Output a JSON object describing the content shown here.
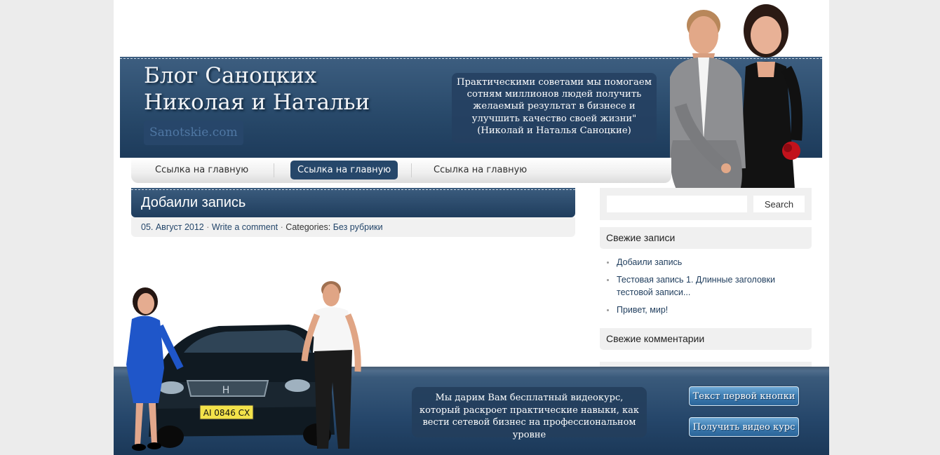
{
  "header": {
    "title_line1": "Блог Саноцких",
    "title_line2": "Николая и Натальи",
    "site_url": "Sanotskie.com",
    "quote": "Практическими советами мы помогаем сотням миллионов людей получить желаемый результат в бизнесе и улучшить качество своей жизни\" (Николай и Наталья Саноцкие)"
  },
  "nav": {
    "items": [
      {
        "label": "Ссылка на главную"
      },
      {
        "label": "Ссылка на главную"
      },
      {
        "label": "Ссылка на главную"
      }
    ]
  },
  "post": {
    "title": "Добаили запись",
    "date": "05. Август 2012",
    "comment_link": "Write a comment",
    "categories_label": "Categories:",
    "category": "Без рубрики",
    "separator": "·"
  },
  "sidebar": {
    "search_placeholder": "",
    "search_button": "Search",
    "recent_posts_title": "Свежие записи",
    "recent_posts": [
      "Добаили запись",
      "Тестовая запись 1. Длинные заголовки тестовой записи...",
      "Привет, мир!"
    ],
    "recent_comments_title": "Свежие комментарии"
  },
  "banner": {
    "offer_text": "Мы дарим Вам бесплатный видеокурс, который раскроет  практические навыки, как вести сетевой бизнес на профессиональном уровне",
    "button1": "Текст первой кнопки",
    "button2": "Получить видео курс",
    "license_plate": "AI 0846 CX"
  },
  "colors": {
    "header_blue": "#294a6b",
    "nav_active": "#26476a",
    "cta_blue": "#3f7fb4",
    "sidebar_bg": "#f0f0f0"
  }
}
